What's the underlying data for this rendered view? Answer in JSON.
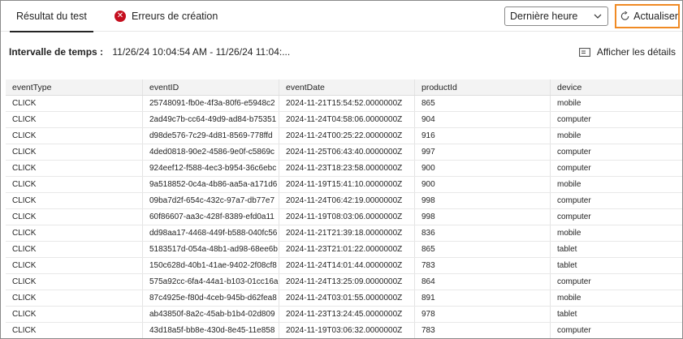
{
  "tabs": {
    "result_label": "Résultat du test",
    "errors_label": "Erreurs de création"
  },
  "time_select": {
    "value": "Dernière heure"
  },
  "refresh_label": "Actualiser",
  "time_range": {
    "label": "Intervalle de temps :",
    "value": "11/26/24 10:04:54 AM - 11/26/24 11:04:..."
  },
  "details_label": "Afficher les détails",
  "colors": {
    "refresh_highlight": "#f08a24",
    "error_icon": "#c50f1f"
  },
  "table": {
    "headers": [
      "eventType",
      "eventID",
      "eventDate",
      "productId",
      "device"
    ],
    "rows": [
      [
        "CLICK",
        "25748091-fb0e-4f3a-80f6-e5948c2",
        "2024-11-21T15:54:52.0000000Z",
        "865",
        "mobile"
      ],
      [
        "CLICK",
        "2ad49c7b-cc64-49d9-ad84-b75351",
        "2024-11-24T04:58:06.0000000Z",
        "904",
        "computer"
      ],
      [
        "CLICK",
        "d98de576-7c29-4d81-8569-778ffd",
        "2024-11-24T00:25:22.0000000Z",
        "916",
        "mobile"
      ],
      [
        "CLICK",
        "4ded0818-90e2-4586-9e0f-c5869c",
        "2024-11-25T06:43:40.0000000Z",
        "997",
        "computer"
      ],
      [
        "CLICK",
        "924eef12-f588-4ec3-b954-36c6ebc",
        "2024-11-23T18:23:58.0000000Z",
        "900",
        "computer"
      ],
      [
        "CLICK",
        "9a518852-0c4a-4b86-aa5a-a171d6",
        "2024-11-19T15:41:10.0000000Z",
        "900",
        "mobile"
      ],
      [
        "CLICK",
        "09ba7d2f-654c-432c-97a7-db77e7",
        "2024-11-24T06:42:19.0000000Z",
        "998",
        "computer"
      ],
      [
        "CLICK",
        "60f86607-aa3c-428f-8389-efd0a11",
        "2024-11-19T08:03:06.0000000Z",
        "998",
        "computer"
      ],
      [
        "CLICK",
        "dd98aa17-4468-449f-b588-040fc56",
        "2024-11-21T21:39:18.0000000Z",
        "836",
        "mobile"
      ],
      [
        "CLICK",
        "5183517d-054a-48b1-ad98-68ee6b",
        "2024-11-23T21:01:22.0000000Z",
        "865",
        "tablet"
      ],
      [
        "CLICK",
        "150c628d-40b1-41ae-9402-2f08cf8",
        "2024-11-24T14:01:44.0000000Z",
        "783",
        "tablet"
      ],
      [
        "CLICK",
        "575a92cc-6fa4-44a1-b103-01cc16a",
        "2024-11-24T13:25:09.0000000Z",
        "864",
        "computer"
      ],
      [
        "CLICK",
        "87c4925e-f80d-4ceb-945b-d62fea8",
        "2024-11-24T03:01:55.0000000Z",
        "891",
        "mobile"
      ],
      [
        "CLICK",
        "ab43850f-8a2c-45ab-b1b4-02d809",
        "2024-11-23T13:24:45.0000000Z",
        "978",
        "tablet"
      ],
      [
        "CLICK",
        "43d18a5f-bb8e-430d-8e45-11e858",
        "2024-11-19T03:06:32.0000000Z",
        "783",
        "computer"
      ]
    ]
  }
}
